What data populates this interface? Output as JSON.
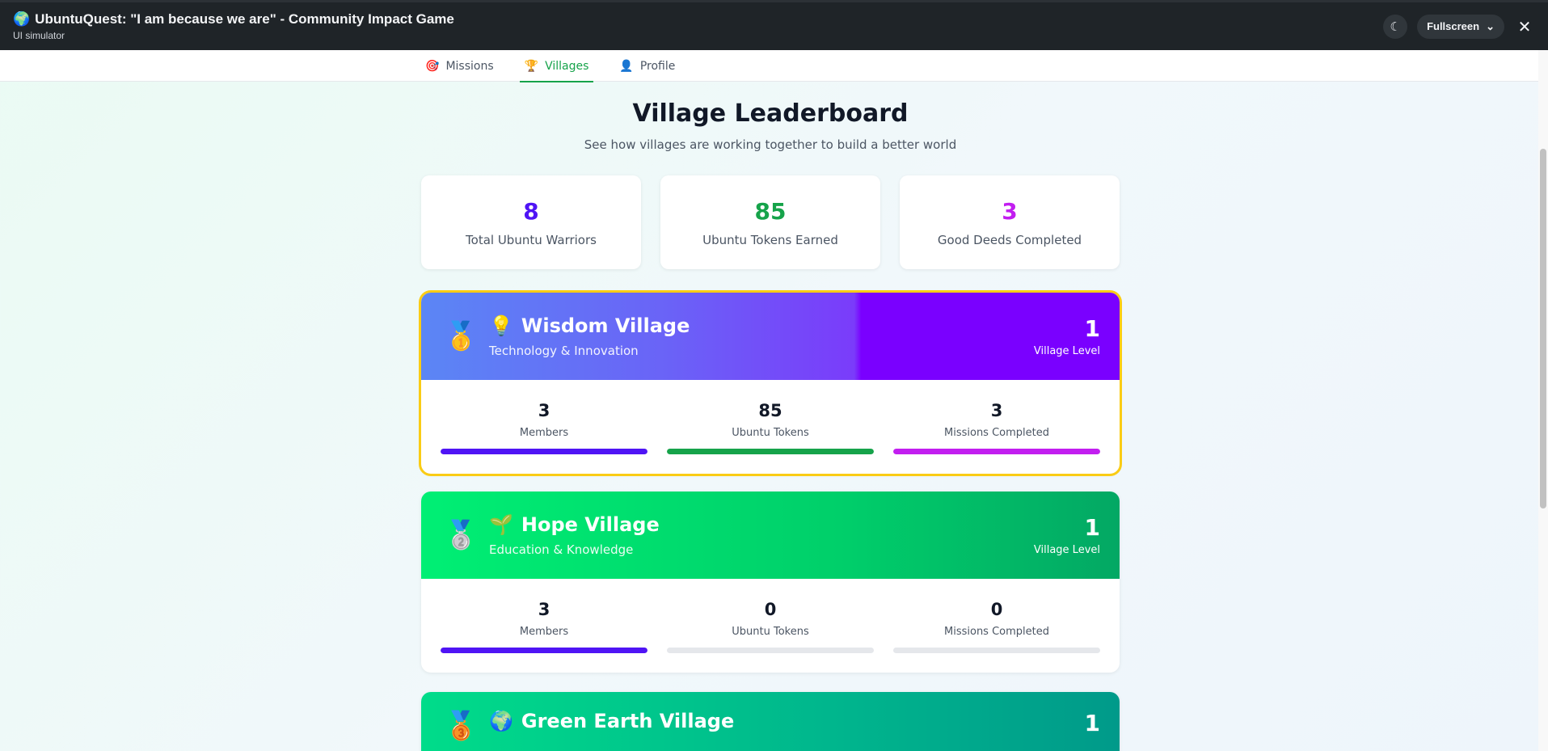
{
  "app": {
    "title": "UbuntuQuest: \"I am because we are\" - Community Impact Game",
    "subtitle": "UI simulator",
    "globe_icon": "🌍",
    "fullscreen_label": "Fullscreen"
  },
  "tabs": [
    {
      "icon": "🎯",
      "label": "Missions",
      "active": false
    },
    {
      "icon": "🏆",
      "label": "Villages",
      "active": true
    },
    {
      "icon": "👤",
      "label": "Profile",
      "active": false
    }
  ],
  "page": {
    "title": "Village Leaderboard",
    "subtitle": "See how villages are working together to build a better world"
  },
  "stats": [
    {
      "value": "8",
      "label": "Total Ubuntu Warriors",
      "color": "#4f14f5"
    },
    {
      "value": "85",
      "label": "Ubuntu Tokens Earned",
      "color": "#16a34a"
    },
    {
      "value": "3",
      "label": "Good Deeds Completed",
      "color": "#c21ef0"
    }
  ],
  "villages": [
    {
      "medal": "🥇",
      "icon": "💡",
      "name": "Wisdom Village",
      "category": "Technology & Innovation",
      "level": "1",
      "level_label": "Village Level",
      "members": "3",
      "members_label": "Members",
      "members_fill": 1.0,
      "tokens": "85",
      "tokens_label": "Ubuntu Tokens",
      "tokens_fill": 1.0,
      "missions": "3",
      "missions_label": "Missions Completed",
      "missions_fill": 1.0
    },
    {
      "medal": "🥈",
      "icon": "🌱",
      "name": "Hope Village",
      "category": "Education & Knowledge",
      "level": "1",
      "level_label": "Village Level",
      "members": "3",
      "members_label": "Members",
      "members_fill": 1.0,
      "tokens": "0",
      "tokens_label": "Ubuntu Tokens",
      "tokens_fill": 0,
      "missions": "0",
      "missions_label": "Missions Completed",
      "missions_fill": 0
    },
    {
      "medal": "🥉",
      "icon": "🌍",
      "name": "Green Earth Village",
      "level": "1"
    }
  ],
  "colors": {
    "members_bar": "#4f14f5",
    "tokens_bar": "#16a34a",
    "missions_bar": "#c21ef0"
  }
}
